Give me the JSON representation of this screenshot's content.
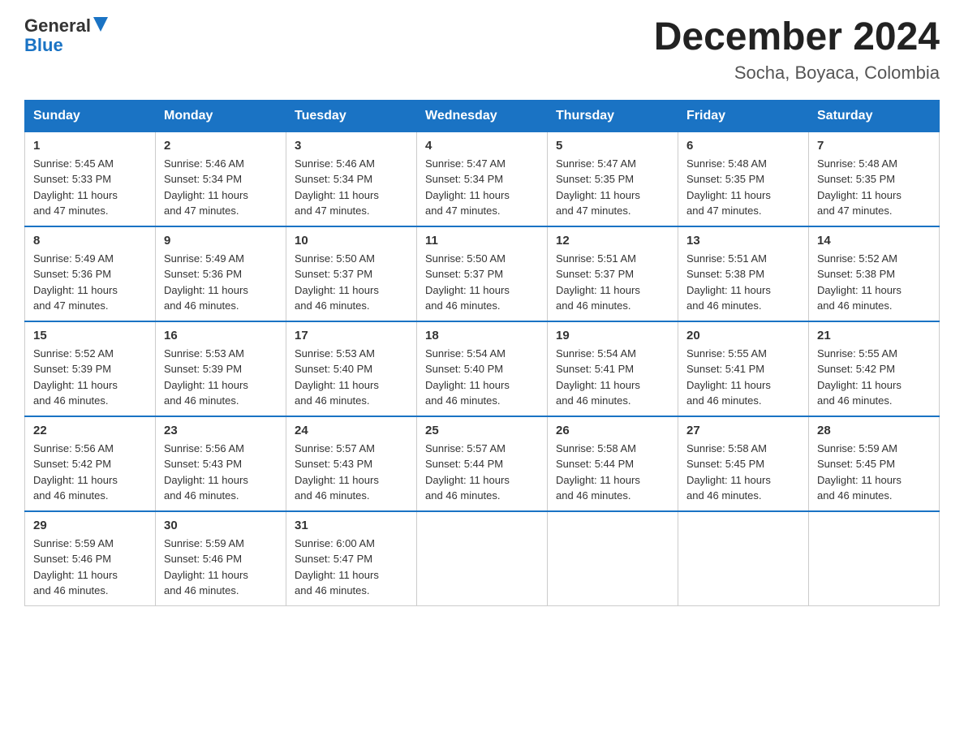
{
  "header": {
    "logo_line1": "General",
    "logo_line2": "Blue",
    "month_title": "December 2024",
    "location": "Socha, Boyaca, Colombia"
  },
  "weekdays": [
    "Sunday",
    "Monday",
    "Tuesday",
    "Wednesday",
    "Thursday",
    "Friday",
    "Saturday"
  ],
  "weeks": [
    [
      {
        "day": "1",
        "sunrise": "5:45 AM",
        "sunset": "5:33 PM",
        "daylight": "11 hours and 47 minutes."
      },
      {
        "day": "2",
        "sunrise": "5:46 AM",
        "sunset": "5:34 PM",
        "daylight": "11 hours and 47 minutes."
      },
      {
        "day": "3",
        "sunrise": "5:46 AM",
        "sunset": "5:34 PM",
        "daylight": "11 hours and 47 minutes."
      },
      {
        "day": "4",
        "sunrise": "5:47 AM",
        "sunset": "5:34 PM",
        "daylight": "11 hours and 47 minutes."
      },
      {
        "day": "5",
        "sunrise": "5:47 AM",
        "sunset": "5:35 PM",
        "daylight": "11 hours and 47 minutes."
      },
      {
        "day": "6",
        "sunrise": "5:48 AM",
        "sunset": "5:35 PM",
        "daylight": "11 hours and 47 minutes."
      },
      {
        "day": "7",
        "sunrise": "5:48 AM",
        "sunset": "5:35 PM",
        "daylight": "11 hours and 47 minutes."
      }
    ],
    [
      {
        "day": "8",
        "sunrise": "5:49 AM",
        "sunset": "5:36 PM",
        "daylight": "11 hours and 47 minutes."
      },
      {
        "day": "9",
        "sunrise": "5:49 AM",
        "sunset": "5:36 PM",
        "daylight": "11 hours and 46 minutes."
      },
      {
        "day": "10",
        "sunrise": "5:50 AM",
        "sunset": "5:37 PM",
        "daylight": "11 hours and 46 minutes."
      },
      {
        "day": "11",
        "sunrise": "5:50 AM",
        "sunset": "5:37 PM",
        "daylight": "11 hours and 46 minutes."
      },
      {
        "day": "12",
        "sunrise": "5:51 AM",
        "sunset": "5:37 PM",
        "daylight": "11 hours and 46 minutes."
      },
      {
        "day": "13",
        "sunrise": "5:51 AM",
        "sunset": "5:38 PM",
        "daylight": "11 hours and 46 minutes."
      },
      {
        "day": "14",
        "sunrise": "5:52 AM",
        "sunset": "5:38 PM",
        "daylight": "11 hours and 46 minutes."
      }
    ],
    [
      {
        "day": "15",
        "sunrise": "5:52 AM",
        "sunset": "5:39 PM",
        "daylight": "11 hours and 46 minutes."
      },
      {
        "day": "16",
        "sunrise": "5:53 AM",
        "sunset": "5:39 PM",
        "daylight": "11 hours and 46 minutes."
      },
      {
        "day": "17",
        "sunrise": "5:53 AM",
        "sunset": "5:40 PM",
        "daylight": "11 hours and 46 minutes."
      },
      {
        "day": "18",
        "sunrise": "5:54 AM",
        "sunset": "5:40 PM",
        "daylight": "11 hours and 46 minutes."
      },
      {
        "day": "19",
        "sunrise": "5:54 AM",
        "sunset": "5:41 PM",
        "daylight": "11 hours and 46 minutes."
      },
      {
        "day": "20",
        "sunrise": "5:55 AM",
        "sunset": "5:41 PM",
        "daylight": "11 hours and 46 minutes."
      },
      {
        "day": "21",
        "sunrise": "5:55 AM",
        "sunset": "5:42 PM",
        "daylight": "11 hours and 46 minutes."
      }
    ],
    [
      {
        "day": "22",
        "sunrise": "5:56 AM",
        "sunset": "5:42 PM",
        "daylight": "11 hours and 46 minutes."
      },
      {
        "day": "23",
        "sunrise": "5:56 AM",
        "sunset": "5:43 PM",
        "daylight": "11 hours and 46 minutes."
      },
      {
        "day": "24",
        "sunrise": "5:57 AM",
        "sunset": "5:43 PM",
        "daylight": "11 hours and 46 minutes."
      },
      {
        "day": "25",
        "sunrise": "5:57 AM",
        "sunset": "5:44 PM",
        "daylight": "11 hours and 46 minutes."
      },
      {
        "day": "26",
        "sunrise": "5:58 AM",
        "sunset": "5:44 PM",
        "daylight": "11 hours and 46 minutes."
      },
      {
        "day": "27",
        "sunrise": "5:58 AM",
        "sunset": "5:45 PM",
        "daylight": "11 hours and 46 minutes."
      },
      {
        "day": "28",
        "sunrise": "5:59 AM",
        "sunset": "5:45 PM",
        "daylight": "11 hours and 46 minutes."
      }
    ],
    [
      {
        "day": "29",
        "sunrise": "5:59 AM",
        "sunset": "5:46 PM",
        "daylight": "11 hours and 46 minutes."
      },
      {
        "day": "30",
        "sunrise": "5:59 AM",
        "sunset": "5:46 PM",
        "daylight": "11 hours and 46 minutes."
      },
      {
        "day": "31",
        "sunrise": "6:00 AM",
        "sunset": "5:47 PM",
        "daylight": "11 hours and 46 minutes."
      },
      null,
      null,
      null,
      null
    ]
  ],
  "labels": {
    "sunrise": "Sunrise:",
    "sunset": "Sunset:",
    "daylight": "Daylight:"
  }
}
